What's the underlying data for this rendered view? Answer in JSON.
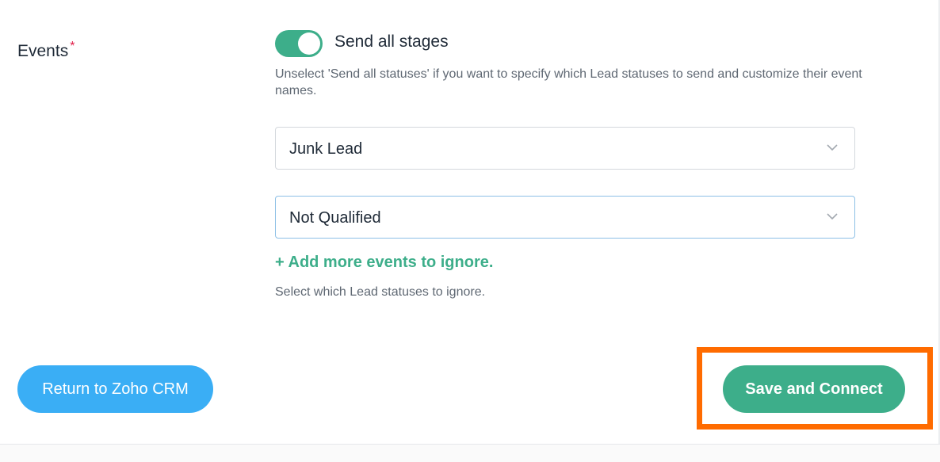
{
  "events": {
    "label": "Events",
    "required_marker": "*",
    "toggle_on": true,
    "toggle_label": "Send all stages",
    "help_text": "Unselect 'Send all statuses' if you want to specify which Lead statuses to send and customize their event names.",
    "selects": [
      {
        "value": "Junk Lead",
        "icon": "chevron-down-icon"
      },
      {
        "value": "Not Qualified",
        "icon": "chevron-down-icon"
      }
    ],
    "add_more_link": "+ Add more events to ignore.",
    "ignore_help": "Select which Lead statuses to ignore."
  },
  "footer": {
    "return_button": "Return to Zoho CRM",
    "save_button": "Save and Connect"
  },
  "colors": {
    "accent_green": "#3dae8a",
    "return_blue": "#3aaef5",
    "highlight_orange": "#ff6b00",
    "required_red": "#e11d48"
  }
}
